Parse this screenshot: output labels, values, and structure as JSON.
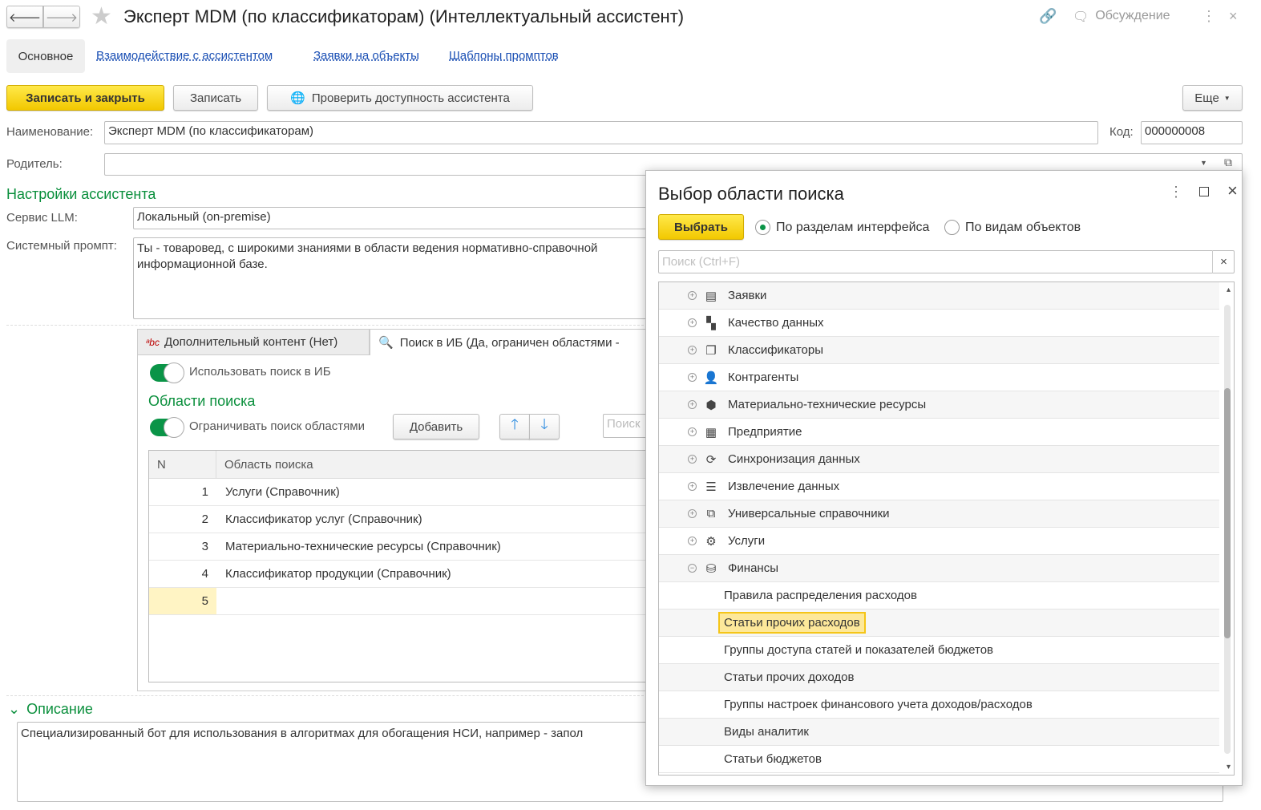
{
  "window": {
    "title": "Эксперт MDM (по классификаторам) (Интеллектуальный ассистент)",
    "discussion": "Обсуждение"
  },
  "nav": {
    "tabs": [
      "Основное",
      "Взаимодействие с ассистентом",
      "Заявки на объекты",
      "Шаблоны промптов"
    ]
  },
  "toolbar": {
    "save_close": "Записать и закрыть",
    "save": "Записать",
    "check": "Проверить доступность ассистента",
    "more": "Еще"
  },
  "form": {
    "name_label": "Наименование:",
    "name_value": "Эксперт MDM (по классификаторам)",
    "code_label": "Код:",
    "code_value": "000000008",
    "parent_label": "Родитель:",
    "parent_value": "",
    "settings_title": "Настройки ассистента",
    "llm_label": "Сервис LLM:",
    "llm_value": "Локальный (on-premise)",
    "prompt_label": "Системный промпт:",
    "prompt_value": "Ты - товаровед, с широкими знаниями в области ведения нормативно-справочной информационной базе."
  },
  "tabs": {
    "extra": "Дополнительный контент (Нет)",
    "search": "Поиск в ИБ (Да, ограничен областями -"
  },
  "search_tab": {
    "use_search": "Использовать поиск в ИБ",
    "areas_title": "Области поиска",
    "limit": "Ограничивать поиск областями",
    "add": "Добавить",
    "search_placeholder": "Поиск",
    "columns": [
      "N",
      "Область поиска"
    ],
    "rows": [
      {
        "n": "1",
        "v": "Услуги (Справочник)"
      },
      {
        "n": "2",
        "v": "Классификатор услуг (Справочник)"
      },
      {
        "n": "3",
        "v": "Материально-технические ресурсы (Справочник)"
      },
      {
        "n": "4",
        "v": "Классификатор продукции (Справочник)"
      },
      {
        "n": "5",
        "v": ""
      }
    ]
  },
  "description": {
    "title": "Описание",
    "text": "Специализированный бот для использования в алгоритмах для обогащения НСИ, например - запол"
  },
  "dialog": {
    "title": "Выбор области поиска",
    "select": "Выбрать",
    "radio1": "По разделам интерфейса",
    "radio2": "По видам объектов",
    "search_placeholder": "Поиск (Ctrl+F)",
    "tree": [
      {
        "label": "Заявки",
        "icon": "document-list-icon",
        "level": 0
      },
      {
        "label": "Качество данных",
        "icon": "blocks-icon",
        "level": 0
      },
      {
        "label": "Классификаторы",
        "icon": "stack-icon",
        "level": 0
      },
      {
        "label": "Контрагенты",
        "icon": "person-icon",
        "level": 0
      },
      {
        "label": "Материально-технические ресурсы",
        "icon": "box-icon",
        "level": 0
      },
      {
        "label": "Предприятие",
        "icon": "building-icon",
        "level": 0
      },
      {
        "label": "Синхронизация данных",
        "icon": "sync-icon",
        "level": 0
      },
      {
        "label": "Извлечение данных",
        "icon": "database-icon",
        "level": 0
      },
      {
        "label": "Универсальные справочники",
        "icon": "copy-icon",
        "level": 0
      },
      {
        "label": "Услуги",
        "icon": "service-icon",
        "level": 0
      },
      {
        "label": "Финансы",
        "icon": "coins-icon",
        "level": 0,
        "expanded": true
      },
      {
        "label": "Правила распределения расходов",
        "level": 1
      },
      {
        "label": "Статьи прочих расходов",
        "level": 1,
        "selected": true
      },
      {
        "label": "Группы доступа статей и показателей бюджетов",
        "level": 1
      },
      {
        "label": "Статьи прочих доходов",
        "level": 1
      },
      {
        "label": "Группы настроек финансового учета доходов/расходов",
        "level": 1
      },
      {
        "label": "Виды аналитик",
        "level": 1
      },
      {
        "label": "Статьи бюджетов",
        "level": 1
      }
    ]
  }
}
